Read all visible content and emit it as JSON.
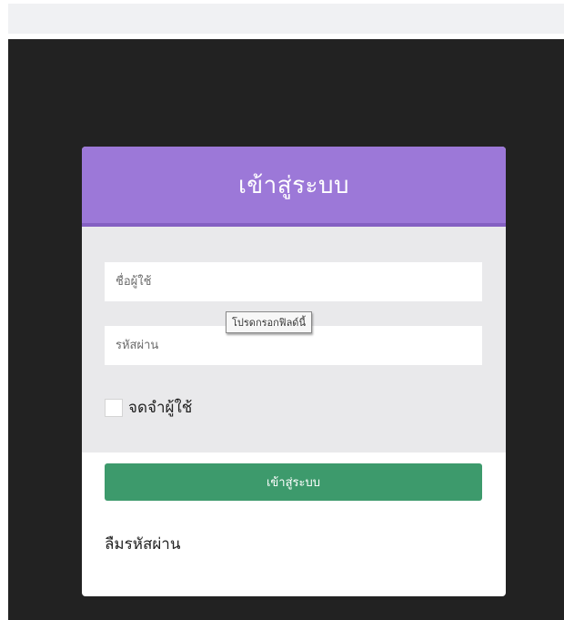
{
  "login": {
    "title": "เข้าสู่ระบบ",
    "username_placeholder": "ชื่อผู้ใช้",
    "password_placeholder": "รหัสผ่าน",
    "tooltip": "โปรดกรอกฟิลด์นี้",
    "remember_label": "จดจำผู้ใช้",
    "submit_label": "เข้าสู่ระบบ",
    "forgot_label": "ลืมรหัสผ่าน"
  },
  "colors": {
    "header": "#9c78d8",
    "button": "#3d9a6c",
    "background": "#222222",
    "form_panel": "#e9e9eb"
  }
}
